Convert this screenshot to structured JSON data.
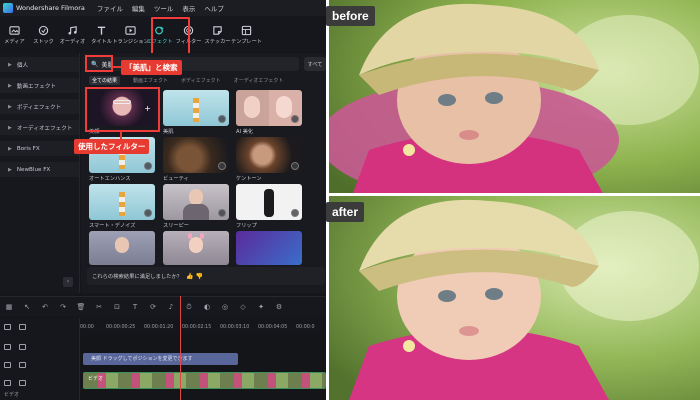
{
  "app": {
    "title": "Wondershare Filmora",
    "menu": [
      "ファイル",
      "編集",
      "ツール",
      "表示",
      "ヘルプ"
    ]
  },
  "toolbar": {
    "items": [
      {
        "label": "メディア",
        "icon": "media-icon"
      },
      {
        "label": "ストック",
        "icon": "stock-icon"
      },
      {
        "label": "オーディオ",
        "icon": "audio-icon"
      },
      {
        "label": "タイトル",
        "icon": "title-icon"
      },
      {
        "label": "トランジション",
        "icon": "transition-icon"
      },
      {
        "label": "エフェクト",
        "icon": "effect-icon"
      },
      {
        "label": "フィルター",
        "icon": "filter-icon"
      },
      {
        "label": "ステッカー",
        "icon": "sticker-icon"
      },
      {
        "label": "テンプレート",
        "icon": "template-icon"
      }
    ],
    "active_label": "エフェクト"
  },
  "sidebar": {
    "items": [
      "個人",
      "動画エフェクト",
      "ボディエフェクト",
      "オーディオエフェクト",
      "Boris FX",
      "NewBlue FX"
    ],
    "collapse_glyph": "‹"
  },
  "search": {
    "value": "美肌",
    "all_button": "すべて"
  },
  "filter_tabs": [
    "全ての結果",
    "動画エフェクト",
    "ボディエフェクト",
    "オーディオエフェクト"
  ],
  "effects": [
    {
      "label": "美顔",
      "theme": "face"
    },
    {
      "label": "美肌",
      "theme": "lighthouse"
    },
    {
      "label": "AI 美化",
      "theme": "faces"
    },
    {
      "label": "オートエンハンス",
      "theme": "lighthouse"
    },
    {
      "label": "ビューティ",
      "theme": "hair"
    },
    {
      "label": "ケントーン",
      "theme": "curls"
    },
    {
      "label": "スマート・デノイズ",
      "theme": "lighthouse"
    },
    {
      "label": "スリーピー",
      "theme": "woman"
    },
    {
      "label": "フリップ",
      "theme": "dark"
    },
    {
      "label": "",
      "theme": "bunny"
    },
    {
      "label": "",
      "theme": "kid"
    },
    {
      "label": "",
      "theme": "purple"
    }
  ],
  "feedback": {
    "text": "これらの検索結果に満足しましたか？",
    "thumbs": "👍 👎"
  },
  "annotations": {
    "search": "「美肌」と検索",
    "filter": "使用したフィルター"
  },
  "timeline": {
    "ruler": [
      "00:00",
      "00:00:00:25",
      "00:00:01:20",
      "00:00:02:15",
      "00:00:03:10",
      "00:00:04:05",
      "00:00:0"
    ],
    "effect_clip": "美顔  ドラッグしてポジションを変更できます",
    "video_clip": "ビデオ",
    "video_track_label": "ビデオ"
  },
  "comparison": {
    "before": "before",
    "after": "after"
  }
}
